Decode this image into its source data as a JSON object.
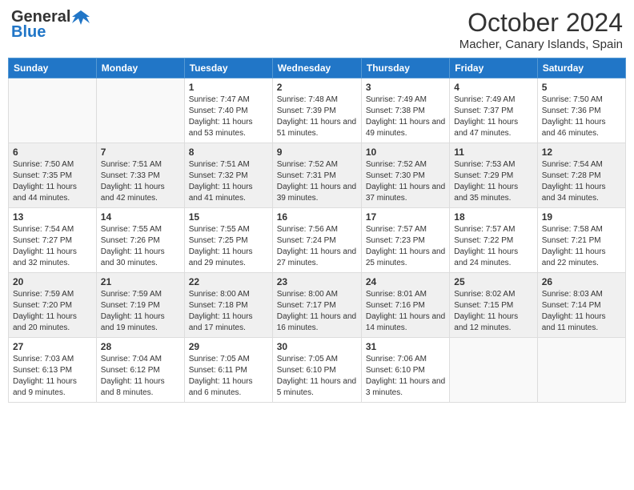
{
  "header": {
    "logo_general": "General",
    "logo_blue": "Blue",
    "month_title": "October 2024",
    "location": "Macher, Canary Islands, Spain"
  },
  "weekdays": [
    "Sunday",
    "Monday",
    "Tuesday",
    "Wednesday",
    "Thursday",
    "Friday",
    "Saturday"
  ],
  "weeks": [
    [
      {
        "day": "",
        "sunrise": "",
        "sunset": "",
        "daylight": ""
      },
      {
        "day": "",
        "sunrise": "",
        "sunset": "",
        "daylight": ""
      },
      {
        "day": "1",
        "sunrise": "Sunrise: 7:47 AM",
        "sunset": "Sunset: 7:40 PM",
        "daylight": "Daylight: 11 hours and 53 minutes."
      },
      {
        "day": "2",
        "sunrise": "Sunrise: 7:48 AM",
        "sunset": "Sunset: 7:39 PM",
        "daylight": "Daylight: 11 hours and 51 minutes."
      },
      {
        "day": "3",
        "sunrise": "Sunrise: 7:49 AM",
        "sunset": "Sunset: 7:38 PM",
        "daylight": "Daylight: 11 hours and 49 minutes."
      },
      {
        "day": "4",
        "sunrise": "Sunrise: 7:49 AM",
        "sunset": "Sunset: 7:37 PM",
        "daylight": "Daylight: 11 hours and 47 minutes."
      },
      {
        "day": "5",
        "sunrise": "Sunrise: 7:50 AM",
        "sunset": "Sunset: 7:36 PM",
        "daylight": "Daylight: 11 hours and 46 minutes."
      }
    ],
    [
      {
        "day": "6",
        "sunrise": "Sunrise: 7:50 AM",
        "sunset": "Sunset: 7:35 PM",
        "daylight": "Daylight: 11 hours and 44 minutes."
      },
      {
        "day": "7",
        "sunrise": "Sunrise: 7:51 AM",
        "sunset": "Sunset: 7:33 PM",
        "daylight": "Daylight: 11 hours and 42 minutes."
      },
      {
        "day": "8",
        "sunrise": "Sunrise: 7:51 AM",
        "sunset": "Sunset: 7:32 PM",
        "daylight": "Daylight: 11 hours and 41 minutes."
      },
      {
        "day": "9",
        "sunrise": "Sunrise: 7:52 AM",
        "sunset": "Sunset: 7:31 PM",
        "daylight": "Daylight: 11 hours and 39 minutes."
      },
      {
        "day": "10",
        "sunrise": "Sunrise: 7:52 AM",
        "sunset": "Sunset: 7:30 PM",
        "daylight": "Daylight: 11 hours and 37 minutes."
      },
      {
        "day": "11",
        "sunrise": "Sunrise: 7:53 AM",
        "sunset": "Sunset: 7:29 PM",
        "daylight": "Daylight: 11 hours and 35 minutes."
      },
      {
        "day": "12",
        "sunrise": "Sunrise: 7:54 AM",
        "sunset": "Sunset: 7:28 PM",
        "daylight": "Daylight: 11 hours and 34 minutes."
      }
    ],
    [
      {
        "day": "13",
        "sunrise": "Sunrise: 7:54 AM",
        "sunset": "Sunset: 7:27 PM",
        "daylight": "Daylight: 11 hours and 32 minutes."
      },
      {
        "day": "14",
        "sunrise": "Sunrise: 7:55 AM",
        "sunset": "Sunset: 7:26 PM",
        "daylight": "Daylight: 11 hours and 30 minutes."
      },
      {
        "day": "15",
        "sunrise": "Sunrise: 7:55 AM",
        "sunset": "Sunset: 7:25 PM",
        "daylight": "Daylight: 11 hours and 29 minutes."
      },
      {
        "day": "16",
        "sunrise": "Sunrise: 7:56 AM",
        "sunset": "Sunset: 7:24 PM",
        "daylight": "Daylight: 11 hours and 27 minutes."
      },
      {
        "day": "17",
        "sunrise": "Sunrise: 7:57 AM",
        "sunset": "Sunset: 7:23 PM",
        "daylight": "Daylight: 11 hours and 25 minutes."
      },
      {
        "day": "18",
        "sunrise": "Sunrise: 7:57 AM",
        "sunset": "Sunset: 7:22 PM",
        "daylight": "Daylight: 11 hours and 24 minutes."
      },
      {
        "day": "19",
        "sunrise": "Sunrise: 7:58 AM",
        "sunset": "Sunset: 7:21 PM",
        "daylight": "Daylight: 11 hours and 22 minutes."
      }
    ],
    [
      {
        "day": "20",
        "sunrise": "Sunrise: 7:59 AM",
        "sunset": "Sunset: 7:20 PM",
        "daylight": "Daylight: 11 hours and 20 minutes."
      },
      {
        "day": "21",
        "sunrise": "Sunrise: 7:59 AM",
        "sunset": "Sunset: 7:19 PM",
        "daylight": "Daylight: 11 hours and 19 minutes."
      },
      {
        "day": "22",
        "sunrise": "Sunrise: 8:00 AM",
        "sunset": "Sunset: 7:18 PM",
        "daylight": "Daylight: 11 hours and 17 minutes."
      },
      {
        "day": "23",
        "sunrise": "Sunrise: 8:00 AM",
        "sunset": "Sunset: 7:17 PM",
        "daylight": "Daylight: 11 hours and 16 minutes."
      },
      {
        "day": "24",
        "sunrise": "Sunrise: 8:01 AM",
        "sunset": "Sunset: 7:16 PM",
        "daylight": "Daylight: 11 hours and 14 minutes."
      },
      {
        "day": "25",
        "sunrise": "Sunrise: 8:02 AM",
        "sunset": "Sunset: 7:15 PM",
        "daylight": "Daylight: 11 hours and 12 minutes."
      },
      {
        "day": "26",
        "sunrise": "Sunrise: 8:03 AM",
        "sunset": "Sunset: 7:14 PM",
        "daylight": "Daylight: 11 hours and 11 minutes."
      }
    ],
    [
      {
        "day": "27",
        "sunrise": "Sunrise: 7:03 AM",
        "sunset": "Sunset: 6:13 PM",
        "daylight": "Daylight: 11 hours and 9 minutes."
      },
      {
        "day": "28",
        "sunrise": "Sunrise: 7:04 AM",
        "sunset": "Sunset: 6:12 PM",
        "daylight": "Daylight: 11 hours and 8 minutes."
      },
      {
        "day": "29",
        "sunrise": "Sunrise: 7:05 AM",
        "sunset": "Sunset: 6:11 PM",
        "daylight": "Daylight: 11 hours and 6 minutes."
      },
      {
        "day": "30",
        "sunrise": "Sunrise: 7:05 AM",
        "sunset": "Sunset: 6:10 PM",
        "daylight": "Daylight: 11 hours and 5 minutes."
      },
      {
        "day": "31",
        "sunrise": "Sunrise: 7:06 AM",
        "sunset": "Sunset: 6:10 PM",
        "daylight": "Daylight: 11 hours and 3 minutes."
      },
      {
        "day": "",
        "sunrise": "",
        "sunset": "",
        "daylight": ""
      },
      {
        "day": "",
        "sunrise": "",
        "sunset": "",
        "daylight": ""
      }
    ]
  ]
}
